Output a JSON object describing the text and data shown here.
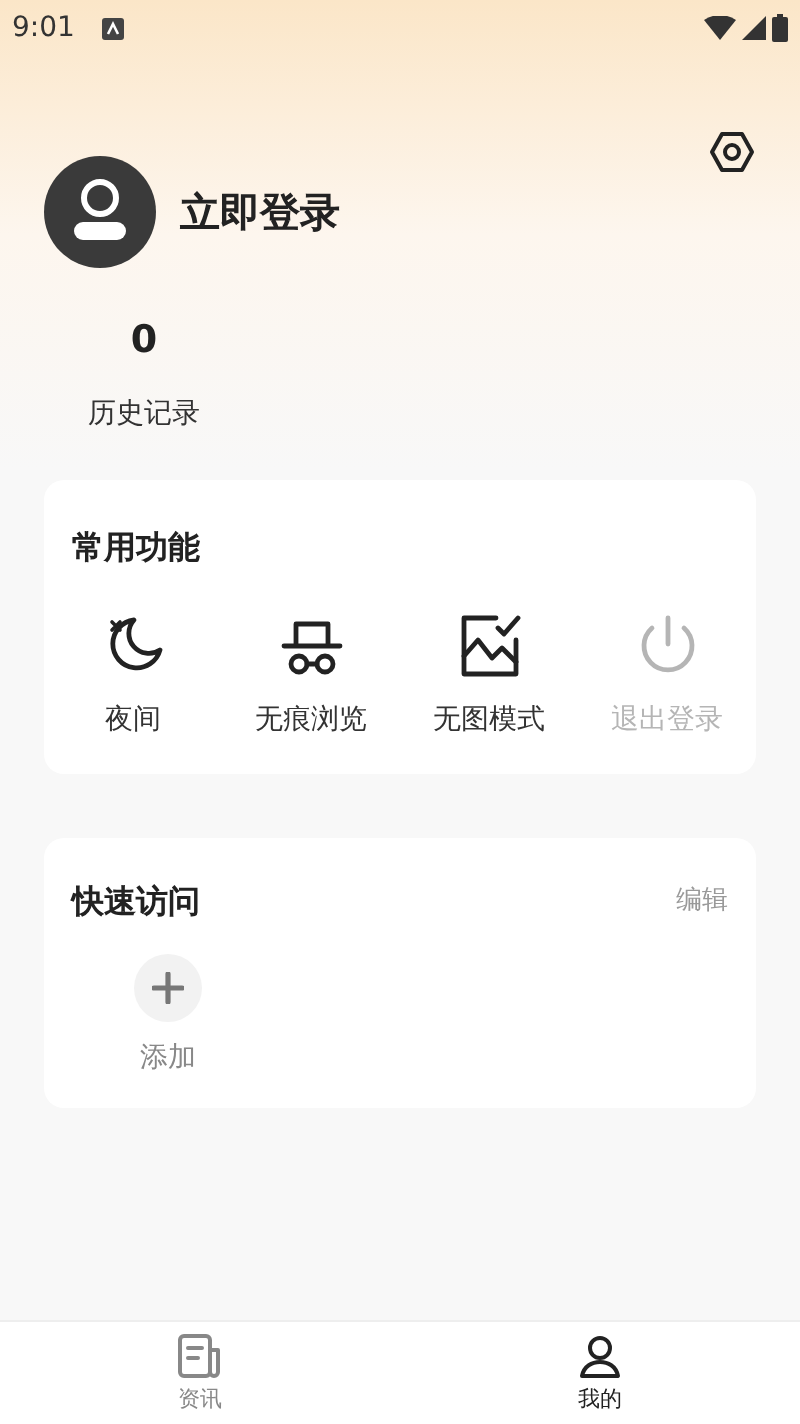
{
  "status_bar": {
    "time": "9:01"
  },
  "profile": {
    "name": "立即登录"
  },
  "stats": [
    {
      "value": "0",
      "label": "历史记录"
    }
  ],
  "common_functions": {
    "title": "常用功能",
    "items": [
      {
        "kind": "night",
        "label": "夜间",
        "disabled": false
      },
      {
        "kind": "incognito",
        "label": "无痕浏览",
        "disabled": false
      },
      {
        "kind": "no-image",
        "label": "无图模式",
        "disabled": false
      },
      {
        "kind": "logout",
        "label": "退出登录",
        "disabled": true
      }
    ]
  },
  "quick_access": {
    "title": "快速访问",
    "edit": "编辑",
    "add_label": "添加"
  },
  "bottom_nav": [
    {
      "kind": "news",
      "label": "资讯",
      "selected": false
    },
    {
      "kind": "me",
      "label": "我的",
      "selected": true
    }
  ]
}
